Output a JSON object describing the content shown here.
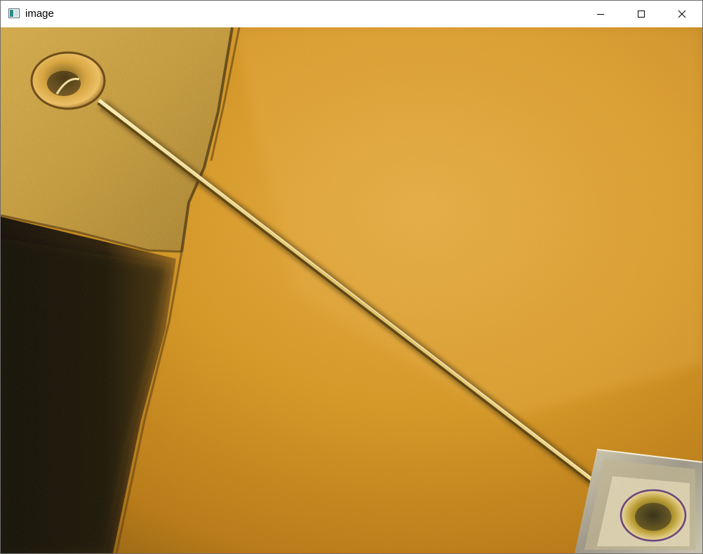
{
  "window": {
    "title": "image",
    "controls": {
      "minimize": "minimize",
      "maximize": "maximize",
      "close": "close"
    }
  },
  "image": {
    "subject": "micrograph-bond-wire",
    "palette": {
      "background_warm": "#c98a1a",
      "background_light": "#e3a83a",
      "pad_gold": "#c99a2e",
      "shadow_dark": "#1c1406",
      "wire": "#f2d48a",
      "pad_frame": "#b7b2a0"
    }
  }
}
